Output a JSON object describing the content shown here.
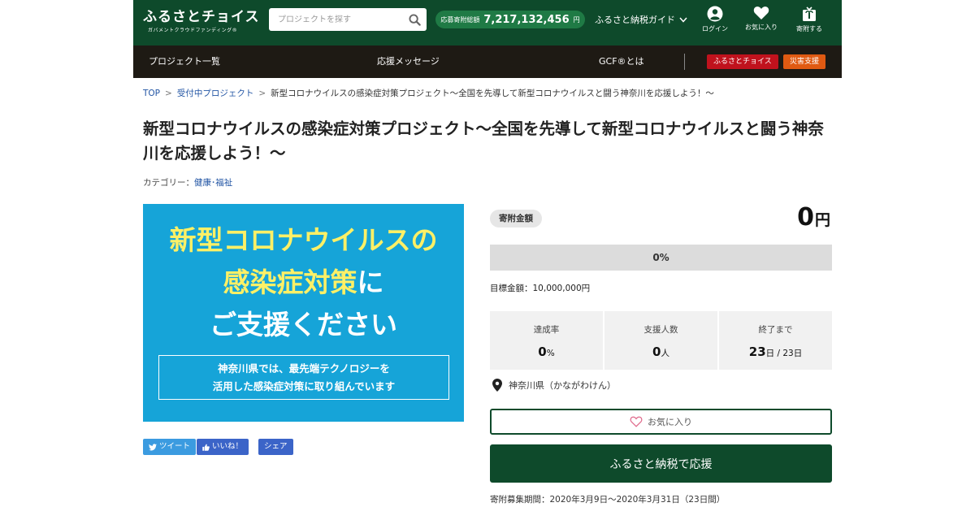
{
  "header": {
    "logo_main": "ふるさとチョイス",
    "logo_sub": "ガバメントクラウドファンディング®",
    "search_placeholder": "プロジェクトを探す",
    "total_label": "応募寄附総額",
    "total_value": "7,217,132,456",
    "total_unit": "円",
    "guide_label": "ふるさと納税ガイド",
    "login_label": "ログイン",
    "favorites_label": "お気に入り",
    "donate_label": "寄附する"
  },
  "nav": {
    "project_list": "プロジェクト一覧",
    "support_messages": "応援メッセージ",
    "gcf_about": "GCF®とは",
    "furusato_choice": "ふるさとチョイス",
    "disaster_support": "災害支援"
  },
  "breadcrumb": {
    "top": "TOP",
    "accepting": "受付中プロジェクト",
    "current": "新型コロナウイルスの感染症対策プロジェクト〜全国を先導して新型コロナウイルスと闘う神奈川を応援しよう！〜"
  },
  "page": {
    "title": "新型コロナウイルスの感染症対策プロジェクト〜全国を先導して新型コロナウイルスと闘う神奈川を応援しよう！〜",
    "category_label": "カテゴリー：",
    "category_value": "健康･福祉"
  },
  "hero": {
    "line1": "新型コロナウイルスの",
    "line2_main": "感染症対策",
    "line2_tail": "に",
    "line3": "ご支援ください",
    "box_line1": "神奈川県では、最先端テクノロジーを",
    "box_line2": "活用した感染症対策に取り組んでいます"
  },
  "share": {
    "tweet": "ツイート",
    "like": "いいね！",
    "share": "シェア"
  },
  "funding": {
    "amount_label": "寄附金額",
    "amount_value": "0",
    "amount_unit": "円",
    "progress_fraction": 0,
    "progress_text": "0%",
    "goal_text": "目標金額：10,000,000円",
    "achievement_label": "達成率",
    "achievement_value": "0",
    "achievement_unit": "%",
    "supporters_label": "支援人数",
    "supporters_value": "0",
    "supporters_unit": "人",
    "remaining_label": "終了まで",
    "remaining_value": "23",
    "remaining_unit": "日 / 23日",
    "location": "神奈川県（かながわけん）",
    "favorite_button": "お気に入り",
    "donate_button": "ふるさと納税で応援",
    "period": "寄附募集期間：2020年3月9日〜2020年3月31日（23日間）"
  },
  "colors": {
    "header_green": "#0e4a2b",
    "nav_dark": "#1e1a14",
    "hero_blue": "#16a4d8",
    "hero_yellow": "#fdf066",
    "badge_red": "#c0121d",
    "badge_orange": "#e05a12",
    "twitter_blue": "#3b9be0",
    "facebook_blue": "#3b64c8"
  },
  "icons": [
    "search-icon",
    "chevron-down-icon",
    "user-icon",
    "heart-icon",
    "gift-icon",
    "twitter-icon",
    "thumbs-up-icon",
    "map-pin-icon",
    "heart-outline-icon"
  ]
}
